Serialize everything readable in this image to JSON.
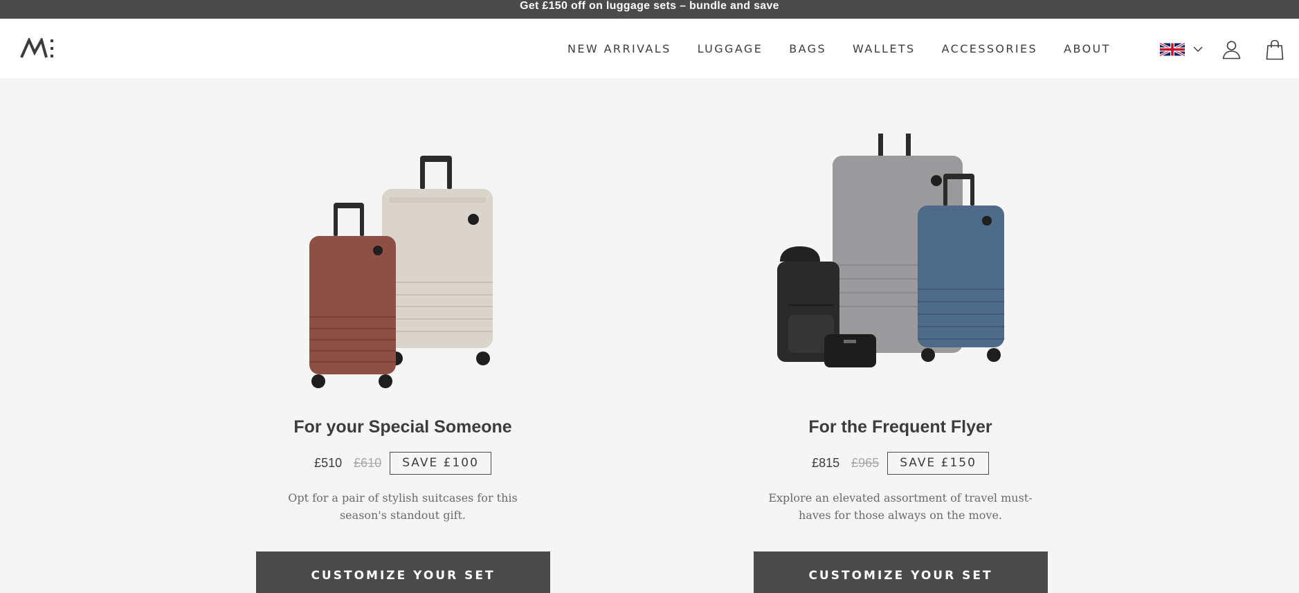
{
  "promo": {
    "text": "Get £150 off on luggage sets – bundle and save"
  },
  "header": {
    "logo_icon": "monos-logo",
    "nav": [
      {
        "label": "NEW ARRIVALS"
      },
      {
        "label": "LUGGAGE"
      },
      {
        "label": "BAGS"
      },
      {
        "label": "WALLETS"
      },
      {
        "label": "ACCESSORIES"
      },
      {
        "label": "ABOUT"
      }
    ],
    "locale_icon": "uk-flag-icon",
    "account_icon": "user-icon",
    "cart_icon": "shopping-bag-icon"
  },
  "cards": [
    {
      "title": "For your Special Someone",
      "price": "£510",
      "old_price": "£610",
      "badge": "SAVE £100",
      "description": "Opt for a pair of stylish suitcases for this season's standout gift.",
      "cta": "CUSTOMIZE YOUR SET"
    },
    {
      "title": "For the Frequent Flyer",
      "price": "£815",
      "old_price": "£965",
      "badge": "SAVE £150",
      "description": "Explore an elevated assortment of travel must-haves for those always on the move.",
      "cta": "CUSTOMIZE YOUR SET"
    }
  ],
  "colors": {
    "promo_bg": "#4a4a4a",
    "page_bg": "#f5f5f5",
    "button_bg": "#4a4a4a",
    "text": "#3c3c3c"
  }
}
